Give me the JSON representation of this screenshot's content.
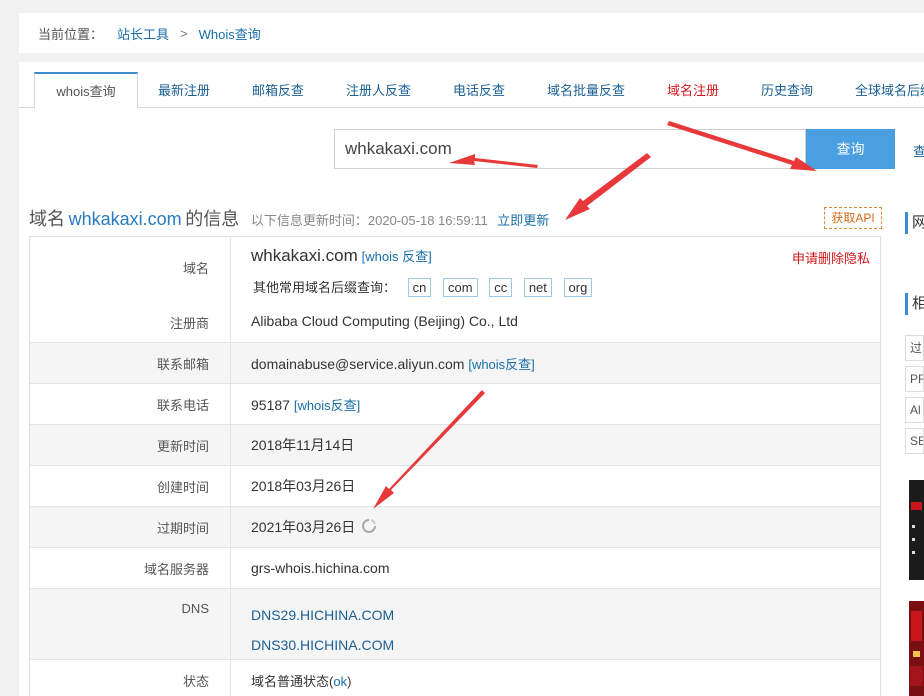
{
  "breadcrumb": {
    "label": "当前位置：",
    "home": "站长工具",
    "sep": ">",
    "current": "Whois查询"
  },
  "tabs": [
    "whois查询",
    "最新注册",
    "邮箱反查",
    "注册人反查",
    "电话反查",
    "域名批量反查",
    "域名注册",
    "历史查询",
    "全球域名后缀"
  ],
  "search": {
    "value": "whkakaxi.com",
    "button": "查询",
    "extra": "查"
  },
  "info": {
    "title_prefix": "域名",
    "domain": "whkakaxi.com",
    "title_suffix": "的信息",
    "update_text": "以下信息更新时间：2020-05-18 16:59:11",
    "update_now": "立即更新",
    "api": "获取API"
  },
  "record": {
    "domain_label": "域名",
    "domain_value": "whkakaxi.com",
    "domain_link": "[whois 反查]",
    "privacy": "申请删除隐私",
    "suffix_label": "其他常用域名后缀查询：",
    "suffixes": [
      "cn",
      "com",
      "cc",
      "net",
      "org"
    ],
    "registrar_label": "注册商",
    "registrar": "Alibaba Cloud Computing (Beijing) Co., Ltd",
    "email_label": "联系邮箱",
    "email": "domainabuse@service.aliyun.com",
    "email_link": "[whois反查]",
    "phone_label": "联系电话",
    "phone": "95187",
    "phone_link": "[whois反查]",
    "updated_label": "更新时间",
    "updated": "2018年11月14日",
    "created_label": "创建时间",
    "created": "2018年03月26日",
    "expires_label": "过期时间",
    "expires": "2021年03月26日",
    "ns_label": "域名服务器",
    "ns": "grs-whois.hichina.com",
    "dns_label": "DNS",
    "dns": [
      "DNS29.HICHINA.COM",
      "DNS30.HICHINA.COM"
    ],
    "status_label": "状态",
    "status_prefix": "域名普通状态(",
    "status_code": "ok",
    "status_suffix": ")"
  },
  "sidebar": {
    "title1": "网",
    "title2": "相",
    "items": [
      "过",
      "PR",
      "Al",
      "SE"
    ]
  },
  "colors": {
    "accent": "#4a9fe0",
    "link": "#1a6ea8",
    "red": "#d1171b",
    "arrow": "#e8393a"
  }
}
